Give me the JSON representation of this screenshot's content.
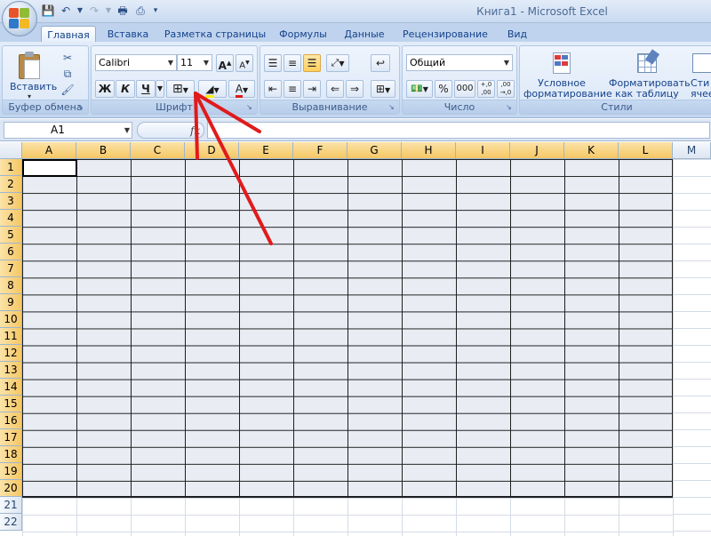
{
  "window": {
    "title": "Книга1 - Microsoft Excel"
  },
  "quick_access": [
    "save-icon",
    "undo-icon",
    "redo-icon",
    "print-preview-icon",
    "print-icon",
    "customize-icon"
  ],
  "tabs": [
    {
      "label": "Главная",
      "active": true
    },
    {
      "label": "Вставка"
    },
    {
      "label": "Разметка страницы"
    },
    {
      "label": "Формулы"
    },
    {
      "label": "Данные"
    },
    {
      "label": "Рецензирование"
    },
    {
      "label": "Вид"
    }
  ],
  "ribbon": {
    "clipboard": {
      "label": "Буфер обмена",
      "paste_label": "Вставить"
    },
    "font": {
      "label": "Шрифт",
      "font_name": "Calibri",
      "font_size": "11",
      "bold": "Ж",
      "italic": "К",
      "underline": "Ч",
      "grow": "A",
      "shrink": "A",
      "color_letter": "A"
    },
    "alignment": {
      "label": "Выравнивание"
    },
    "number": {
      "label": "Число",
      "format": "Общий",
      "percent": "%",
      "thousands": "000",
      "inc_decimal": "+,0\n,00",
      "dec_decimal": ",00\n→,0"
    },
    "styles": {
      "label": "Стили",
      "conditional_1": "Условное",
      "conditional_2": "форматирование",
      "table_1": "Форматировать",
      "table_2": "как таблицу",
      "cell_1": "Сти",
      "cell_2": "ячее"
    }
  },
  "formula_bar": {
    "name_box": "A1",
    "fx": "fx",
    "content": ""
  },
  "sheet": {
    "columns": [
      "A",
      "B",
      "C",
      "D",
      "E",
      "F",
      "G",
      "H",
      "I",
      "J",
      "K",
      "L",
      "M"
    ],
    "rows": [
      "1",
      "2",
      "3",
      "4",
      "5",
      "6",
      "7",
      "8",
      "9",
      "10",
      "11",
      "12",
      "13",
      "14",
      "15",
      "16",
      "17",
      "18",
      "19",
      "20",
      "21",
      "22"
    ],
    "selected_range": "A1:L20",
    "active_cell": "A1"
  },
  "colors": {
    "accent": "#15428b",
    "annotation_arrow": "#e01b1b",
    "selection_fill": "#e9ecf3",
    "header_selected": "#f6c765"
  }
}
